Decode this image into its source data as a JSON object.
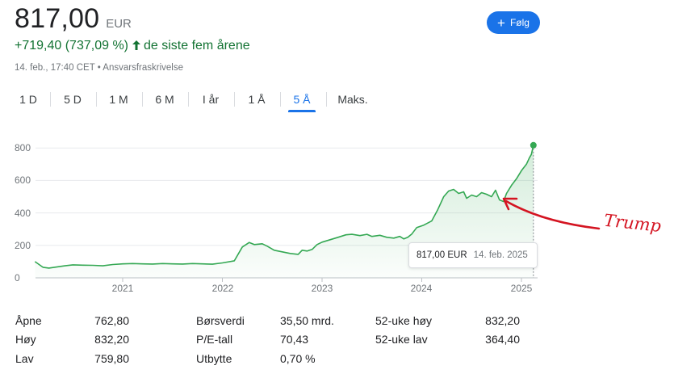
{
  "quote": {
    "price": "817,00",
    "currency": "EUR",
    "change": "+719,40 (737,09 %)",
    "change_arrow": "🡑",
    "period_text": "de siste fem årene",
    "meta": "14. feb., 17:40 CET • Ansvarsfraskrivelse"
  },
  "follow_button": {
    "icon": "plus-icon",
    "label": "Følg"
  },
  "colors": {
    "accent": "#1a73e8",
    "positive": "#137333",
    "line": "#34a853",
    "annotation": "#d41421"
  },
  "tabs": [
    {
      "label": "1 D",
      "active": false
    },
    {
      "label": "5 D",
      "active": false
    },
    {
      "label": "1 M",
      "active": false
    },
    {
      "label": "6 M",
      "active": false
    },
    {
      "label": "I år",
      "active": false
    },
    {
      "label": "1 Å",
      "active": false
    },
    {
      "label": "5 Å",
      "active": true
    },
    {
      "label": "Maks.",
      "active": false
    }
  ],
  "tooltip": {
    "price": "817,00 EUR",
    "date": "14. feb. 2025"
  },
  "annotation": {
    "text": "Trump"
  },
  "stats": [
    {
      "label": "Åpne",
      "value": "762,80"
    },
    {
      "label": "Høy",
      "value": "832,20"
    },
    {
      "label": "Lav",
      "value": "759,80"
    },
    {
      "label": "Børsverdi",
      "value": "35,50 mrd."
    },
    {
      "label": "P/E-tall",
      "value": "70,43"
    },
    {
      "label": "Utbytte",
      "value": "0,70 %"
    },
    {
      "label": "52-uke høy",
      "value": "832,20"
    },
    {
      "label": "52-uke lav",
      "value": "364,40"
    }
  ],
  "chart_data": {
    "type": "area",
    "y_ticks": [
      "800",
      "600",
      "400",
      "200",
      "0"
    ],
    "ylim": [
      0,
      850
    ],
    "x_ticks": [
      "2021",
      "2022",
      "2023",
      "2024",
      "2025"
    ],
    "grid": true,
    "series": [
      {
        "values": [
          [
            2020.12,
            100
          ],
          [
            2020.2,
            65
          ],
          [
            2020.26,
            60
          ],
          [
            2020.35,
            68
          ],
          [
            2020.42,
            74
          ],
          [
            2020.5,
            80
          ],
          [
            2020.6,
            78
          ],
          [
            2020.7,
            77
          ],
          [
            2020.8,
            74
          ],
          [
            2020.9,
            82
          ],
          [
            2021.0,
            86
          ],
          [
            2021.1,
            88
          ],
          [
            2021.2,
            86
          ],
          [
            2021.3,
            85
          ],
          [
            2021.4,
            88
          ],
          [
            2021.5,
            86
          ],
          [
            2021.6,
            85
          ],
          [
            2021.7,
            88
          ],
          [
            2021.8,
            86
          ],
          [
            2021.9,
            84
          ],
          [
            2022.0,
            92
          ],
          [
            2022.12,
            105
          ],
          [
            2022.2,
            190
          ],
          [
            2022.27,
            218
          ],
          [
            2022.32,
            205
          ],
          [
            2022.4,
            210
          ],
          [
            2022.45,
            195
          ],
          [
            2022.52,
            170
          ],
          [
            2022.6,
            160
          ],
          [
            2022.68,
            150
          ],
          [
            2022.76,
            145
          ],
          [
            2022.8,
            170
          ],
          [
            2022.85,
            165
          ],
          [
            2022.9,
            175
          ],
          [
            2022.95,
            205
          ],
          [
            2023.0,
            220
          ],
          [
            2023.08,
            235
          ],
          [
            2023.16,
            250
          ],
          [
            2023.24,
            265
          ],
          [
            2023.3,
            268
          ],
          [
            2023.38,
            260
          ],
          [
            2023.45,
            268
          ],
          [
            2023.5,
            255
          ],
          [
            2023.58,
            262
          ],
          [
            2023.65,
            250
          ],
          [
            2023.72,
            245
          ],
          [
            2023.78,
            255
          ],
          [
            2023.82,
            240
          ],
          [
            2023.86,
            250
          ],
          [
            2023.9,
            270
          ],
          [
            2023.95,
            310
          ],
          [
            2024.02,
            325
          ],
          [
            2024.1,
            350
          ],
          [
            2024.16,
            420
          ],
          [
            2024.22,
            500
          ],
          [
            2024.27,
            535
          ],
          [
            2024.32,
            545
          ],
          [
            2024.37,
            520
          ],
          [
            2024.42,
            530
          ],
          [
            2024.45,
            490
          ],
          [
            2024.5,
            510
          ],
          [
            2024.55,
            500
          ],
          [
            2024.6,
            525
          ],
          [
            2024.65,
            515
          ],
          [
            2024.7,
            500
          ],
          [
            2024.74,
            540
          ],
          [
            2024.78,
            480
          ],
          [
            2024.82,
            470
          ],
          [
            2024.85,
            520
          ],
          [
            2024.9,
            570
          ],
          [
            2024.95,
            610
          ],
          [
            2025.0,
            660
          ],
          [
            2025.05,
            700
          ],
          [
            2025.08,
            740
          ],
          [
            2025.1,
            760
          ],
          [
            2025.12,
            817
          ]
        ]
      }
    ]
  }
}
